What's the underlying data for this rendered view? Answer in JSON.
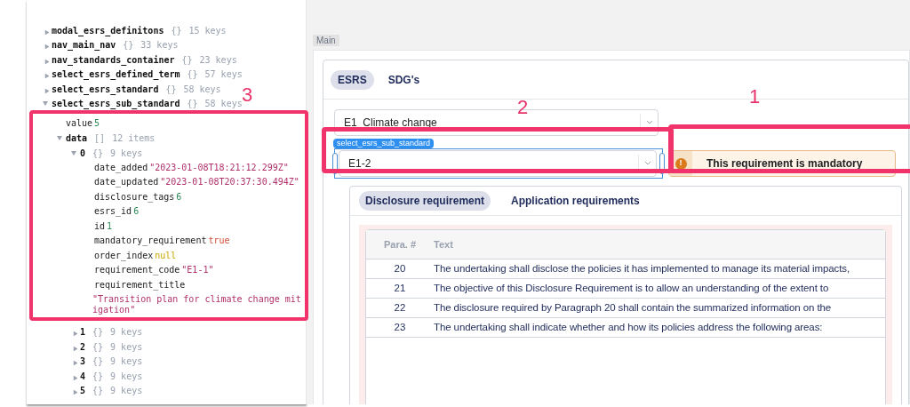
{
  "inspector": {
    "nodes": [
      {
        "key": "modal_esrs_definitons",
        "kind": "branch",
        "brackets": "{}",
        "summary": "15 keys",
        "expanded": false
      },
      {
        "key": "nav_main_nav",
        "kind": "branch",
        "brackets": "{}",
        "summary": "33 keys",
        "expanded": false
      },
      {
        "key": "nav_standards_container",
        "kind": "branch",
        "brackets": "{}",
        "summary": "23 keys",
        "expanded": false
      },
      {
        "key": "select_esrs_defined_term",
        "kind": "branch",
        "brackets": "{}",
        "summary": "57 keys",
        "expanded": false
      },
      {
        "key": "select_esrs_standard",
        "kind": "branch",
        "brackets": "{}",
        "summary": "58 keys",
        "expanded": false
      },
      {
        "key": "select_esrs_sub_standard",
        "kind": "branch",
        "brackets": "{}",
        "summary": "58 keys",
        "expanded": true,
        "children": [
          {
            "key": "value",
            "kind": "number",
            "value": "5"
          },
          {
            "key": "data",
            "kind": "branch",
            "brackets": "[]",
            "summary": "12 items",
            "expanded": true,
            "children": [
              {
                "key": "0",
                "kind": "branch",
                "brackets": "{}",
                "summary": "9 keys",
                "expanded": true,
                "children": [
                  {
                    "key": "date_added",
                    "kind": "string",
                    "value": "\"2023-01-08T18:21:12.299Z\""
                  },
                  {
                    "key": "date_updated",
                    "kind": "string",
                    "value": "\"2023-01-08T20:37:30.494Z\""
                  },
                  {
                    "key": "disclosure_tags",
                    "kind": "number",
                    "value": "6"
                  },
                  {
                    "key": "esrs_id",
                    "kind": "number",
                    "value": "6"
                  },
                  {
                    "key": "id",
                    "kind": "number",
                    "value": "1"
                  },
                  {
                    "key": "mandatory_requirement",
                    "kind": "boolean",
                    "value": "true"
                  },
                  {
                    "key": "order_index",
                    "kind": "null",
                    "value": "null"
                  },
                  {
                    "key": "requirement_code",
                    "kind": "string",
                    "value": "\"E1-1\""
                  },
                  {
                    "key": "requirement_title",
                    "kind": "string",
                    "value": "\"Transition plan for climate change mitigation\""
                  }
                ]
              },
              {
                "key": "1",
                "kind": "branch",
                "brackets": "{}",
                "summary": "9 keys",
                "expanded": false
              },
              {
                "key": "2",
                "kind": "branch",
                "brackets": "{}",
                "summary": "9 keys",
                "expanded": false
              },
              {
                "key": "3",
                "kind": "branch",
                "brackets": "{}",
                "summary": "9 keys",
                "expanded": false
              },
              {
                "key": "4",
                "kind": "branch",
                "brackets": "{}",
                "summary": "9 keys",
                "expanded": false
              },
              {
                "key": "5",
                "kind": "branch",
                "brackets": "{}",
                "summary": "9 keys",
                "expanded": false
              }
            ]
          }
        ]
      }
    ]
  },
  "main": {
    "container_label": "Main",
    "tabs": [
      {
        "label": "ESRS",
        "selected": true
      },
      {
        "label": "SDG's",
        "selected": false
      }
    ],
    "standard_select": {
      "value": "E1  Climate change"
    },
    "component_tag": "select_esrs_sub_standard",
    "sub_standard_select": {
      "value": "E1-2"
    },
    "alert": {
      "icon": "!",
      "text": "This requirement is mandatory"
    },
    "sub_tabs": [
      {
        "label": "Disclosure requirement",
        "selected": true
      },
      {
        "label": "Application requirements",
        "selected": false
      }
    ],
    "table": {
      "columns": [
        "Para. #",
        "Text"
      ],
      "rows": [
        [
          "20",
          "The undertaking shall disclose the policies it has implemented to manage its material impacts,"
        ],
        [
          "21",
          "The objective of this Disclosure Requirement is to allow an understanding of the extent to"
        ],
        [
          "22",
          "The disclosure required by Paragraph 20 shall contain the summarized information on the"
        ],
        [
          "23",
          "The undertaking shall indicate whether and how its policies address the following areas:"
        ]
      ]
    }
  },
  "annotations": [
    {
      "label": "3"
    },
    {
      "label": "2"
    },
    {
      "label": "1"
    }
  ]
}
